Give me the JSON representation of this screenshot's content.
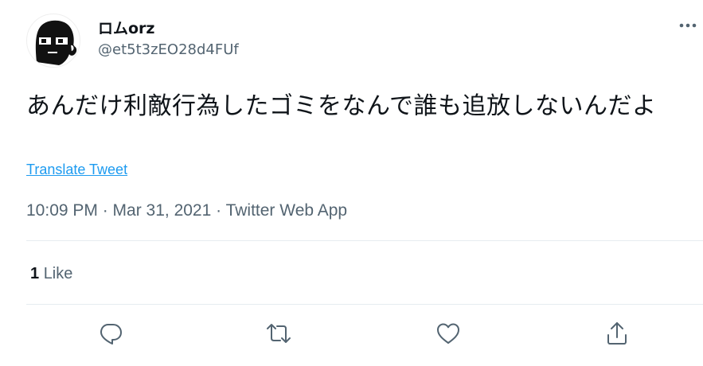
{
  "author": {
    "display_name": "ロムorz",
    "handle": "@et5t3zEO28d4FUf",
    "avatar_icon": "glasses-face-avatar-icon"
  },
  "tweet": {
    "text": "あんだけ利敵行為したゴミをなんで誰も追放しないんだよ",
    "translate_label": "Translate Tweet",
    "meta": "10:09 PM · Mar 31, 2021 · Twitter Web App"
  },
  "stats": {
    "likes_count": "1",
    "likes_label": "Like"
  },
  "actions": {
    "reply_icon": "reply-icon",
    "retweet_icon": "retweet-icon",
    "like_icon": "like-heart-icon",
    "share_icon": "share-icon"
  },
  "colors": {
    "text_primary": "#0f1419",
    "text_secondary": "#536471",
    "link": "#1d9bf0",
    "divider": "#e6ecf0"
  }
}
